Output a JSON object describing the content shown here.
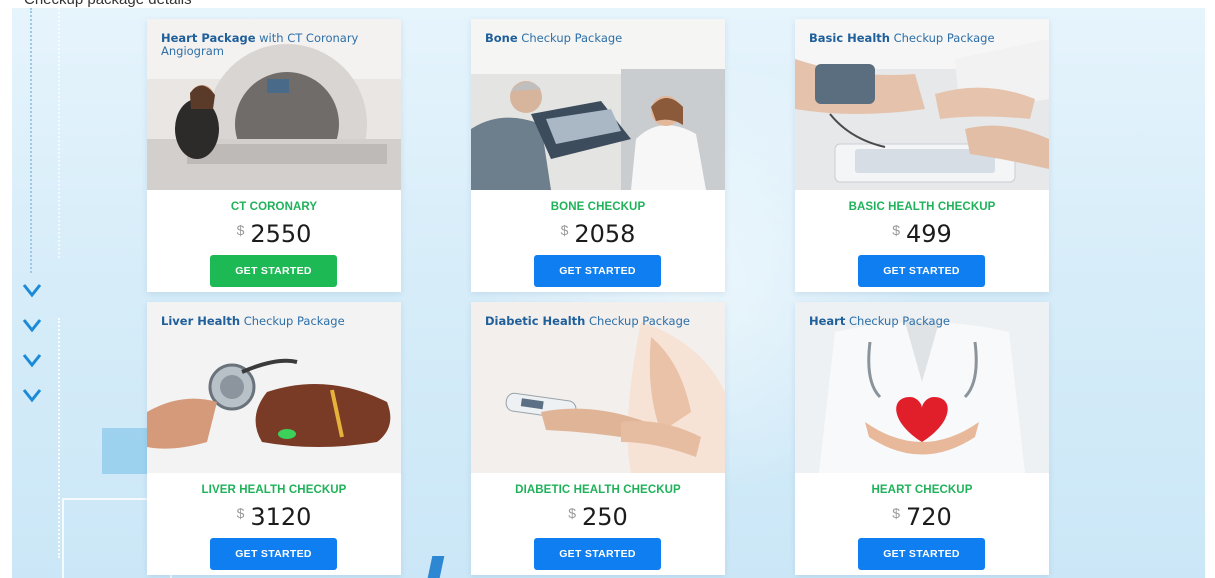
{
  "page_heading": "Checkup package details",
  "colors": {
    "name_text": "#1fb25a",
    "button_blue": "#0f7ef0",
    "button_green": "#1db954",
    "background": "#d7edf9"
  },
  "decor_icons": [
    "chevron-down-icon",
    "chevron-down-icon",
    "chevron-down-icon",
    "chevron-down-icon",
    "medical-cross-icon"
  ],
  "packages": [
    {
      "banner_bold": "Heart Package",
      "banner_rest": " with CT Coronary Angiogram",
      "name": "CT CORONARY",
      "currency": "$",
      "price": "2550",
      "button": "GET STARTED",
      "image": "ct-scanner-image"
    },
    {
      "banner_bold": "Bone",
      "banner_rest": " Checkup Package",
      "name": "BONE CHECKUP",
      "currency": "$",
      "price": "2058",
      "button": "GET STARTED",
      "image": "xray-consultation-image"
    },
    {
      "banner_bold": "Basic Health",
      "banner_rest": " Checkup Package",
      "name": "BASIC HEALTH CHECKUP",
      "currency": "$",
      "price": "499",
      "button": "GET STARTED",
      "image": "blood-pressure-image"
    },
    {
      "banner_bold": "Liver Health",
      "banner_rest": " Checkup Package",
      "name": "LIVER HEALTH CHECKUP",
      "currency": "$",
      "price": "3120",
      "button": "GET STARTED",
      "image": "liver-stethoscope-image"
    },
    {
      "banner_bold": "Diabetic Health",
      "banner_rest": " Checkup Package",
      "name": "DIABETIC HEALTH CHECKUP",
      "currency": "$",
      "price": "250",
      "button": "GET STARTED",
      "image": "glucose-meter-image"
    },
    {
      "banner_bold": "Heart",
      "banner_rest": " Checkup Package",
      "name": "HEART CHECKUP",
      "currency": "$",
      "price": "720",
      "button": "GET STARTED",
      "image": "heart-in-hands-image"
    }
  ]
}
